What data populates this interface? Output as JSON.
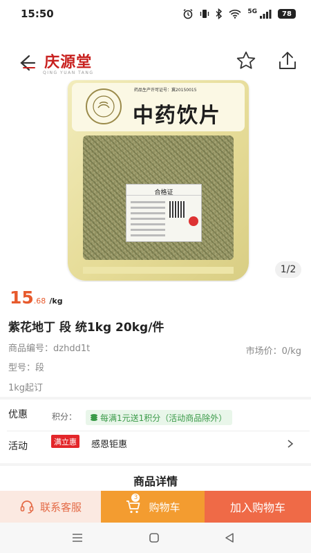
{
  "status_bar": {
    "time": "15:50",
    "network": "5G",
    "battery": "78",
    "icons": [
      "alarm-icon",
      "vibrate-icon",
      "bluetooth-icon",
      "wifi-icon",
      "signal-icon",
      "battery-icon"
    ]
  },
  "header": {
    "logo_text": "庆源堂",
    "logo_sub": "QING YUAN TANG",
    "icons": [
      "back-arrow-icon",
      "star-icon",
      "share-icon"
    ]
  },
  "product_image": {
    "package_title": "中药饮片",
    "license_text": "药品生产许可证号：冀20150015",
    "certificate_title": "合格证",
    "counter": "1/2"
  },
  "product": {
    "price_int": "15",
    "price_dec": ".68",
    "price_unit": "/kg",
    "title": "紫花地丁 段 统1kg 20kg/件",
    "code": "商品编号：dzhdd1t",
    "market_price": "市场价：0/kg",
    "model": "型号：段",
    "moq": "1kg起订"
  },
  "promo": {
    "discount_label": "优惠",
    "points_label": "积分：",
    "points_text": "每满1元送1积分（活动商品除外）",
    "activity_label": "活动",
    "activity_badge": "满立惠",
    "activity_text": "感恩钜惠"
  },
  "details": {
    "title": "商品详情"
  },
  "actions": {
    "service": "联系客服",
    "cart": "购物车",
    "cart_count": "3",
    "add_to_cart": "加入购物车"
  },
  "colors": {
    "accent": "#e75a2d",
    "cart_button": "#f39c30",
    "add_button": "#ef6a47",
    "service_bg": "#fbe9e1",
    "points_green": "#3a9a48",
    "badge_red": "#e3262a"
  }
}
